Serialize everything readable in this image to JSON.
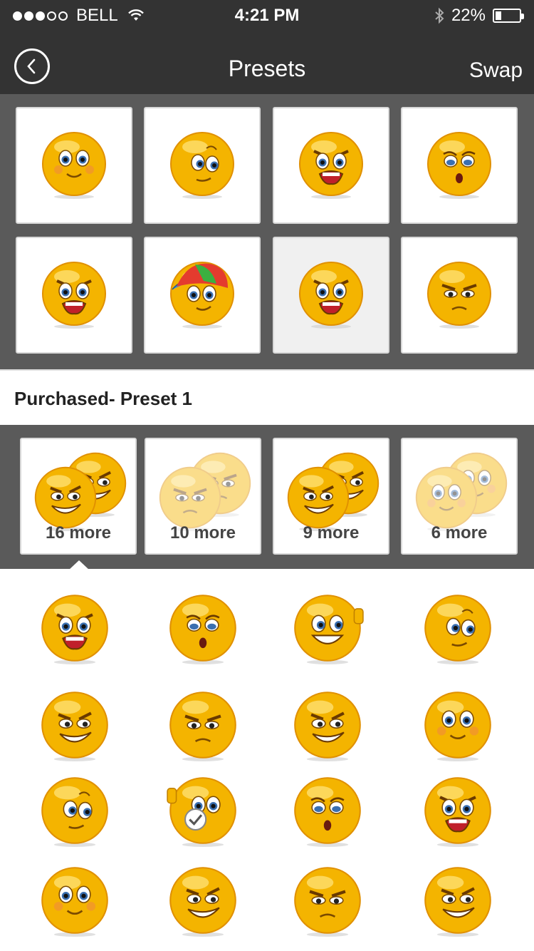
{
  "status_bar": {
    "carrier": "BELL",
    "time": "4:21 PM",
    "battery": "22%",
    "battery_level": 0.22
  },
  "nav": {
    "back_icon": "chevron-left-icon",
    "title": "Presets",
    "swap_label": "Swap"
  },
  "presets": [
    {
      "expression": "happy-blush",
      "color": "#f4b400"
    },
    {
      "expression": "curious",
      "color": "#f4b400"
    },
    {
      "expression": "angry-yell",
      "color": "#f4b400"
    },
    {
      "expression": "surprised",
      "color": "#f4b400"
    },
    {
      "expression": "angry-yell",
      "color": "#f4b400"
    },
    {
      "expression": "cap-smile",
      "color": "#f4b400"
    },
    {
      "expression": "angry-yell",
      "color": "#f4b400"
    },
    {
      "expression": "grumpy",
      "color": "#f4b400"
    }
  ],
  "selected_preset_index": 6,
  "purchased": {
    "title": "Purchased- Preset 1"
  },
  "more_groups": [
    {
      "label": "16 more",
      "expression": "sly",
      "faded": false
    },
    {
      "label": "10 more",
      "expression": "grumpy",
      "faded": true
    },
    {
      "label": "9 more",
      "expression": "sly",
      "faded": false
    },
    {
      "label": "6 more",
      "expression": "happy-blush",
      "faded": true
    }
  ],
  "emojis": [
    {
      "expression": "angry-yell"
    },
    {
      "expression": "surprised"
    },
    {
      "expression": "thumbs-grin"
    },
    {
      "expression": "curious"
    },
    {
      "expression": "sly"
    },
    {
      "expression": "grumpy"
    },
    {
      "expression": "sly"
    },
    {
      "expression": "happy-blush"
    },
    {
      "expression": "curious"
    },
    {
      "expression": "thumbs-check"
    },
    {
      "expression": "surprised"
    },
    {
      "expression": "angry-yell"
    },
    {
      "expression": "happy-blush"
    },
    {
      "expression": "sly"
    },
    {
      "expression": "grumpy"
    },
    {
      "expression": "sly"
    }
  ],
  "colors": {
    "bar": "#333333",
    "panel": "#5a5a5a",
    "emoji_yellow": "#f4b400"
  }
}
